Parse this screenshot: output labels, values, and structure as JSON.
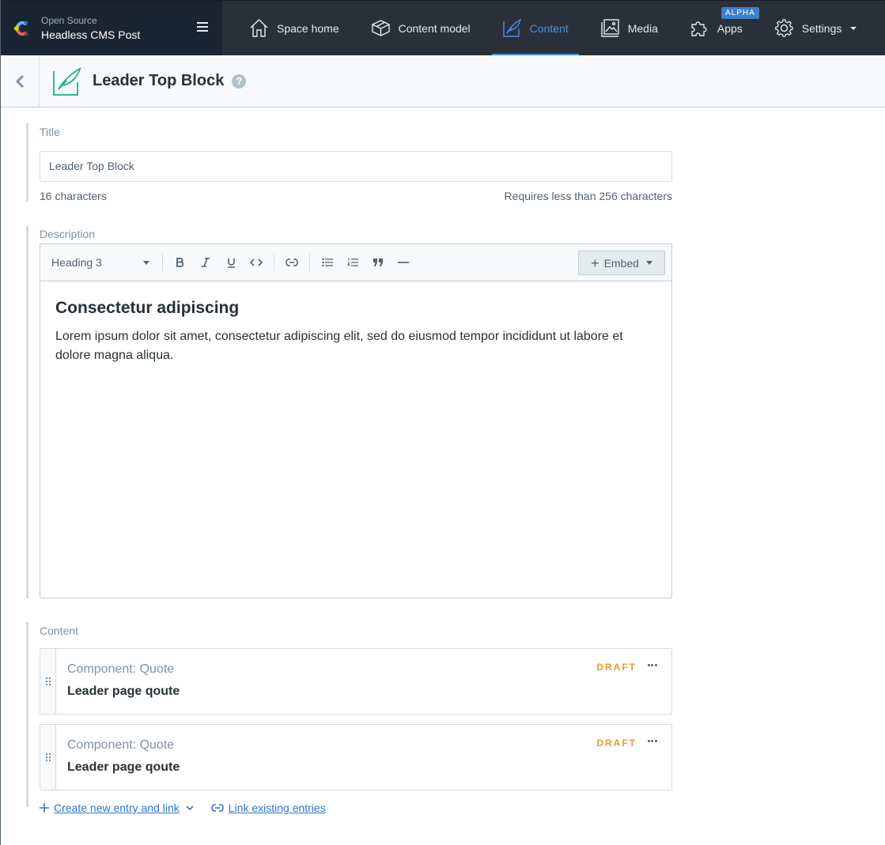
{
  "space": {
    "org": "Open Source",
    "name": "Headless CMS Post"
  },
  "nav": {
    "items": [
      {
        "label": "Space home",
        "icon": "house-icon"
      },
      {
        "label": "Content model",
        "icon": "cube-icon"
      },
      {
        "label": "Content",
        "icon": "feather-icon",
        "active": true
      },
      {
        "label": "Media",
        "icon": "image-icon"
      },
      {
        "label": "Apps",
        "icon": "puzzle-icon",
        "badge": "ALPHA"
      },
      {
        "label": "Settings",
        "icon": "gear-icon"
      }
    ]
  },
  "entry": {
    "title": "Leader Top Block",
    "help": "?"
  },
  "title_field": {
    "label": "Title",
    "value": "Leader Top Block",
    "count": "16 characters",
    "limit": "Requires less than 256 characters"
  },
  "description_field": {
    "label": "Description",
    "heading_select": "Heading 3",
    "embed_label": "Embed",
    "heading": "Consectetur adipiscing",
    "paragraph": "Lorem ipsum dolor sit amet, consectetur adipiscing elit, sed do eiusmod tempor incididunt ut labore et dolore magna aliqua."
  },
  "content_field": {
    "label": "Content",
    "references": [
      {
        "type": "Component: Quote",
        "title": "Leader page qoute",
        "status": "DRAFT"
      },
      {
        "type": "Component: Quote",
        "title": "Leader page qoute",
        "status": "DRAFT"
      }
    ],
    "create_link": "Create new entry and link",
    "link_existing": "Link existing entries"
  },
  "colors": {
    "nav_bg": "#2a3039",
    "active": "#4a90e2",
    "draft": "#e39e2d",
    "link": "#2e75d4"
  }
}
